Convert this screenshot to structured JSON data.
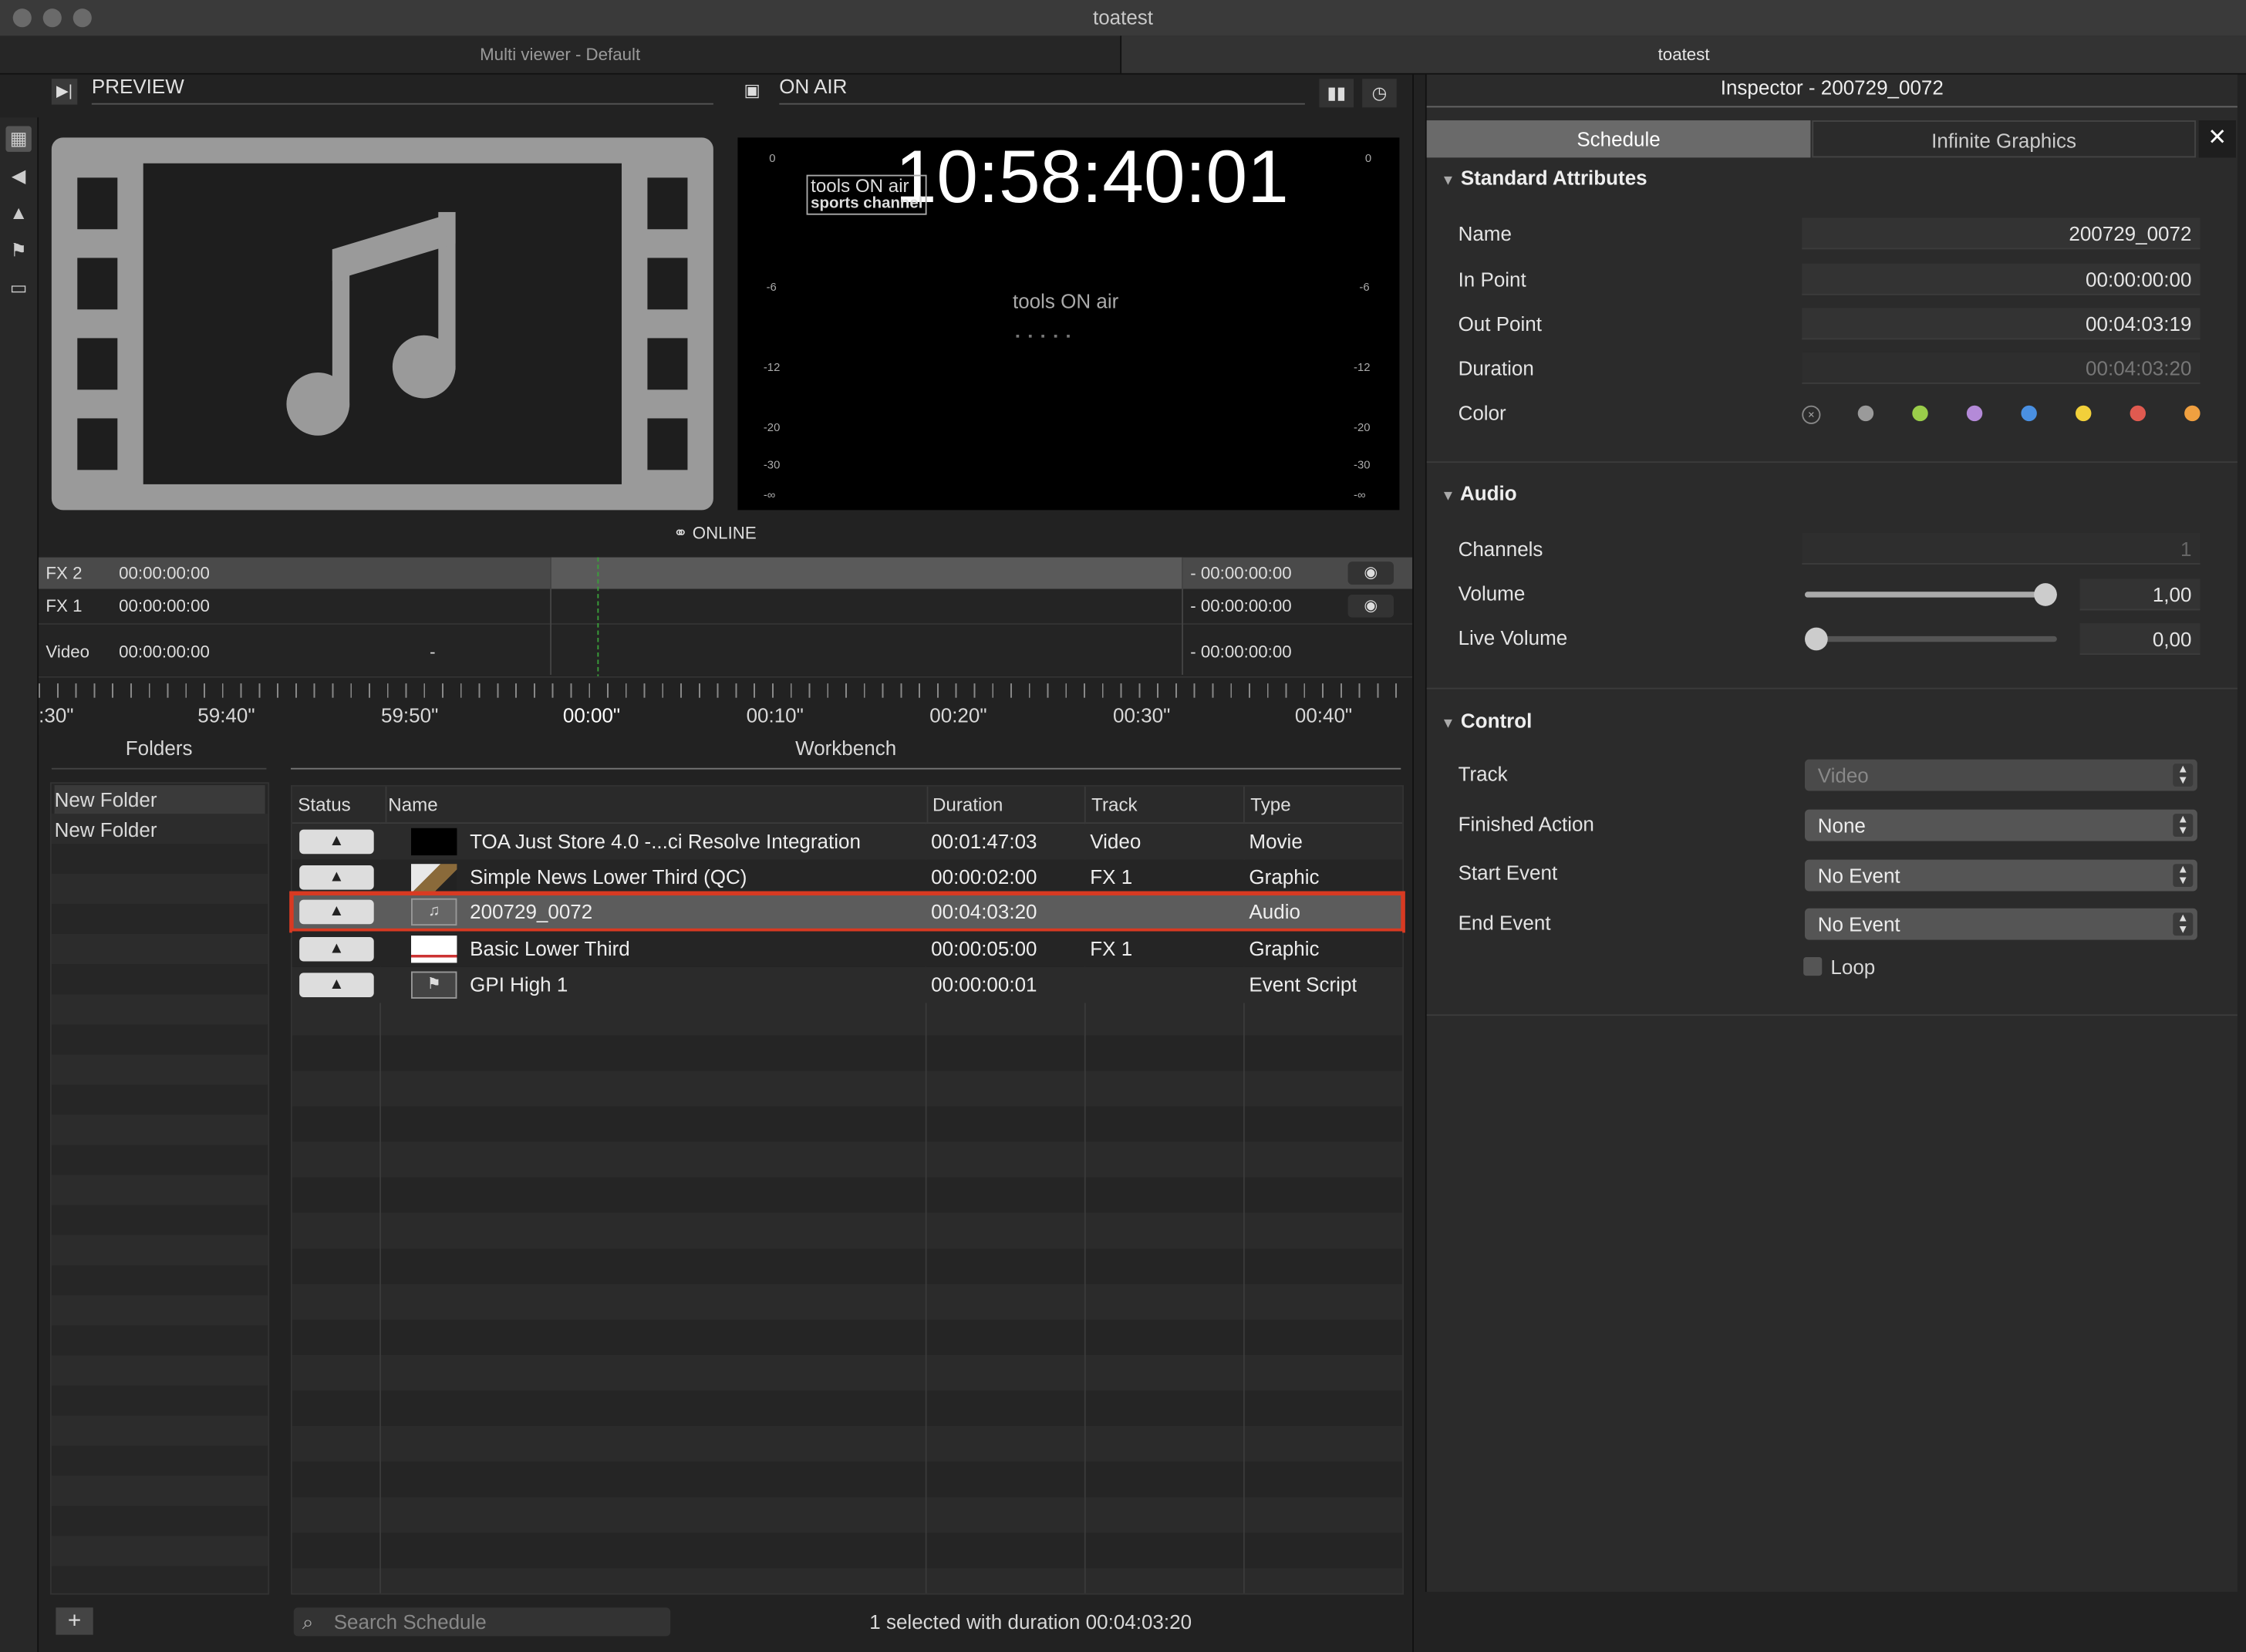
{
  "window": {
    "title": "toatest"
  },
  "tabs": [
    {
      "label": "Multi viewer - Default"
    },
    {
      "label": "toatest"
    }
  ],
  "preview": {
    "title": "PREVIEW"
  },
  "onair": {
    "title": "ON AIR",
    "timecode": "10:58:40:01",
    "brand": "tools ON air",
    "channel": "sports channel",
    "status": "ONLINE",
    "meter_labels": [
      "0",
      "-6",
      "-12",
      "-20",
      "-30",
      "-∞"
    ]
  },
  "timeline": {
    "tracks": [
      {
        "name": "FX 2",
        "in": "00:00:00:00",
        "out": "- 00:00:00:00"
      },
      {
        "name": "FX 1",
        "in": "00:00:00:00",
        "out": "- 00:00:00:00"
      },
      {
        "name": "Video",
        "in": "00:00:00:00",
        "mid": "-",
        "out": "- 00:00:00:00"
      }
    ],
    "ruler": [
      ":30\"",
      "59:40\"",
      "59:50\"",
      "00:00\"",
      "00:10\"",
      "00:20\"",
      "00:30\"",
      "00:40\""
    ]
  },
  "folders": {
    "title": "Folders",
    "items": [
      {
        "label": "New Folder"
      },
      {
        "label": "New Folder"
      }
    ]
  },
  "workbench": {
    "title": "Workbench",
    "columns": [
      "Status",
      "Name",
      "Duration",
      "Track",
      "Type"
    ],
    "rows": [
      {
        "status": "▲",
        "name": "TOA Just Store 4.0 -...ci Resolve Integration",
        "duration": "00:01:47:03",
        "track": "Video",
        "type": "Movie"
      },
      {
        "status": "▲",
        "name": "Simple News Lower Third (QC)",
        "duration": "00:00:02:00",
        "track": "FX 1",
        "type": "Graphic"
      },
      {
        "status": "▲",
        "name": "200729_0072",
        "duration": "00:04:03:20",
        "track": "",
        "type": "Audio"
      },
      {
        "status": "▲",
        "name": "Basic Lower Third",
        "duration": "00:00:05:00",
        "track": "FX 1",
        "type": "Graphic"
      },
      {
        "status": "▲",
        "name": "GPI High 1",
        "duration": "00:00:00:01",
        "track": "",
        "type": "Event Script"
      }
    ],
    "search_placeholder": "Search Schedule",
    "summary": "1 selected with duration 00:04:03:20"
  },
  "inspector": {
    "title": "Inspector - 200729_0072",
    "tabs": [
      "Schedule",
      "Infinite Graphics"
    ],
    "standard": {
      "title": "Standard Attributes",
      "name_label": "Name",
      "name_value": "200729_0072",
      "in_label": "In Point",
      "in_value": "00:00:00:00",
      "out_label": "Out Point",
      "out_value": "00:04:03:19",
      "duration_label": "Duration",
      "duration_value": "00:04:03:20",
      "color_label": "Color",
      "colors": [
        "#9a9a9a",
        "#9acd4a",
        "#b48ad8",
        "#4a90e2",
        "#f2d03a",
        "#e05a50",
        "#f0a040"
      ]
    },
    "audio": {
      "title": "Audio",
      "channels_label": "Channels",
      "channels_value": "1",
      "volume_label": "Volume",
      "volume_value": "1,00",
      "volume_level": 1.0,
      "live_label": "Live Volume",
      "live_value": "0,00",
      "live_level": 0.0
    },
    "control": {
      "title": "Control",
      "track_label": "Track",
      "track_value": "Video",
      "finished_label": "Finished Action",
      "finished_value": "None",
      "start_label": "Start Event",
      "start_value": "No Event",
      "end_label": "End Event",
      "end_value": "No Event",
      "loop_label": "Loop"
    }
  }
}
